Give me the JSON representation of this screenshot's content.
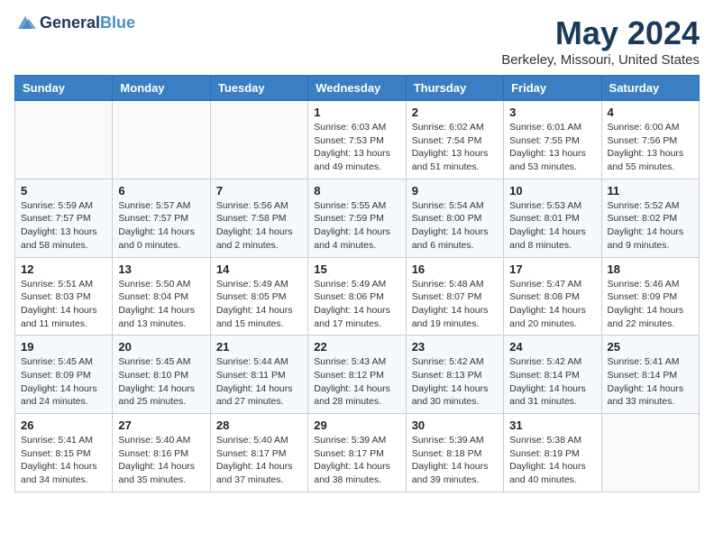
{
  "header": {
    "logo_line1": "General",
    "logo_line2": "Blue",
    "month": "May 2024",
    "location": "Berkeley, Missouri, United States"
  },
  "weekdays": [
    "Sunday",
    "Monday",
    "Tuesday",
    "Wednesday",
    "Thursday",
    "Friday",
    "Saturday"
  ],
  "weeks": [
    [
      {
        "day": "",
        "info": ""
      },
      {
        "day": "",
        "info": ""
      },
      {
        "day": "",
        "info": ""
      },
      {
        "day": "1",
        "info": "Sunrise: 6:03 AM\nSunset: 7:53 PM\nDaylight: 13 hours\nand 49 minutes."
      },
      {
        "day": "2",
        "info": "Sunrise: 6:02 AM\nSunset: 7:54 PM\nDaylight: 13 hours\nand 51 minutes."
      },
      {
        "day": "3",
        "info": "Sunrise: 6:01 AM\nSunset: 7:55 PM\nDaylight: 13 hours\nand 53 minutes."
      },
      {
        "day": "4",
        "info": "Sunrise: 6:00 AM\nSunset: 7:56 PM\nDaylight: 13 hours\nand 55 minutes."
      }
    ],
    [
      {
        "day": "5",
        "info": "Sunrise: 5:59 AM\nSunset: 7:57 PM\nDaylight: 13 hours\nand 58 minutes."
      },
      {
        "day": "6",
        "info": "Sunrise: 5:57 AM\nSunset: 7:57 PM\nDaylight: 14 hours\nand 0 minutes."
      },
      {
        "day": "7",
        "info": "Sunrise: 5:56 AM\nSunset: 7:58 PM\nDaylight: 14 hours\nand 2 minutes."
      },
      {
        "day": "8",
        "info": "Sunrise: 5:55 AM\nSunset: 7:59 PM\nDaylight: 14 hours\nand 4 minutes."
      },
      {
        "day": "9",
        "info": "Sunrise: 5:54 AM\nSunset: 8:00 PM\nDaylight: 14 hours\nand 6 minutes."
      },
      {
        "day": "10",
        "info": "Sunrise: 5:53 AM\nSunset: 8:01 PM\nDaylight: 14 hours\nand 8 minutes."
      },
      {
        "day": "11",
        "info": "Sunrise: 5:52 AM\nSunset: 8:02 PM\nDaylight: 14 hours\nand 9 minutes."
      }
    ],
    [
      {
        "day": "12",
        "info": "Sunrise: 5:51 AM\nSunset: 8:03 PM\nDaylight: 14 hours\nand 11 minutes."
      },
      {
        "day": "13",
        "info": "Sunrise: 5:50 AM\nSunset: 8:04 PM\nDaylight: 14 hours\nand 13 minutes."
      },
      {
        "day": "14",
        "info": "Sunrise: 5:49 AM\nSunset: 8:05 PM\nDaylight: 14 hours\nand 15 minutes."
      },
      {
        "day": "15",
        "info": "Sunrise: 5:49 AM\nSunset: 8:06 PM\nDaylight: 14 hours\nand 17 minutes."
      },
      {
        "day": "16",
        "info": "Sunrise: 5:48 AM\nSunset: 8:07 PM\nDaylight: 14 hours\nand 19 minutes."
      },
      {
        "day": "17",
        "info": "Sunrise: 5:47 AM\nSunset: 8:08 PM\nDaylight: 14 hours\nand 20 minutes."
      },
      {
        "day": "18",
        "info": "Sunrise: 5:46 AM\nSunset: 8:09 PM\nDaylight: 14 hours\nand 22 minutes."
      }
    ],
    [
      {
        "day": "19",
        "info": "Sunrise: 5:45 AM\nSunset: 8:09 PM\nDaylight: 14 hours\nand 24 minutes."
      },
      {
        "day": "20",
        "info": "Sunrise: 5:45 AM\nSunset: 8:10 PM\nDaylight: 14 hours\nand 25 minutes."
      },
      {
        "day": "21",
        "info": "Sunrise: 5:44 AM\nSunset: 8:11 PM\nDaylight: 14 hours\nand 27 minutes."
      },
      {
        "day": "22",
        "info": "Sunrise: 5:43 AM\nSunset: 8:12 PM\nDaylight: 14 hours\nand 28 minutes."
      },
      {
        "day": "23",
        "info": "Sunrise: 5:42 AM\nSunset: 8:13 PM\nDaylight: 14 hours\nand 30 minutes."
      },
      {
        "day": "24",
        "info": "Sunrise: 5:42 AM\nSunset: 8:14 PM\nDaylight: 14 hours\nand 31 minutes."
      },
      {
        "day": "25",
        "info": "Sunrise: 5:41 AM\nSunset: 8:14 PM\nDaylight: 14 hours\nand 33 minutes."
      }
    ],
    [
      {
        "day": "26",
        "info": "Sunrise: 5:41 AM\nSunset: 8:15 PM\nDaylight: 14 hours\nand 34 minutes."
      },
      {
        "day": "27",
        "info": "Sunrise: 5:40 AM\nSunset: 8:16 PM\nDaylight: 14 hours\nand 35 minutes."
      },
      {
        "day": "28",
        "info": "Sunrise: 5:40 AM\nSunset: 8:17 PM\nDaylight: 14 hours\nand 37 minutes."
      },
      {
        "day": "29",
        "info": "Sunrise: 5:39 AM\nSunset: 8:17 PM\nDaylight: 14 hours\nand 38 minutes."
      },
      {
        "day": "30",
        "info": "Sunrise: 5:39 AM\nSunset: 8:18 PM\nDaylight: 14 hours\nand 39 minutes."
      },
      {
        "day": "31",
        "info": "Sunrise: 5:38 AM\nSunset: 8:19 PM\nDaylight: 14 hours\nand 40 minutes."
      },
      {
        "day": "",
        "info": ""
      }
    ]
  ]
}
